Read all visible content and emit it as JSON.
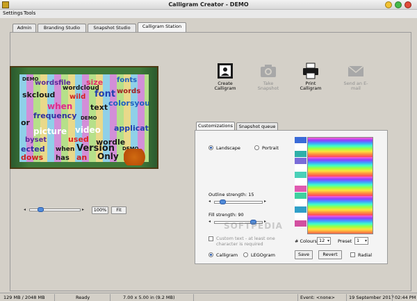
{
  "window": {
    "title": "Calligram Creator - DEMO"
  },
  "menu": [
    {
      "label": "Settings"
    },
    {
      "label": "Tools"
    }
  ],
  "tabs": [
    {
      "label": "Admin"
    },
    {
      "label": "Branding Studio"
    },
    {
      "label": "Snapshot Studio"
    },
    {
      "label": "Calligram Station",
      "active": true
    }
  ],
  "preview": {
    "words": [
      "DEMO",
      "wordsfile",
      "size",
      "fonts",
      "wordcloud",
      "skcloud",
      "wild",
      "font",
      "words",
      "when",
      "text",
      "colorsyou",
      "frequency",
      "or",
      "DEMO",
      "picture",
      "video",
      "applicati",
      "byset",
      "used",
      "wordle",
      "ected",
      "when",
      "Version",
      "dows",
      "has",
      "an",
      "Only",
      "DEMO"
    ],
    "zoom_label": "100%",
    "fit_label": "Fit"
  },
  "actions": [
    {
      "label": "Create Calligram",
      "icon": "portrait-frame-icon",
      "enabled": true
    },
    {
      "label": "Take Snapshot",
      "icon": "camera-icon",
      "enabled": false
    },
    {
      "label": "Print Calligram",
      "icon": "printer-icon",
      "enabled": true
    },
    {
      "label": "Send an E-mail",
      "icon": "envelope-icon",
      "enabled": false
    }
  ],
  "subtabs": [
    {
      "label": "Customizations",
      "active": true
    },
    {
      "label": "Snapshot queue"
    }
  ],
  "customizations": {
    "orientation": {
      "landscape": "Landscape",
      "portrait": "Portrait",
      "selected": "Landscape"
    },
    "outline_label": "Outline strength: 15",
    "outline_value": 15,
    "fill_label": "Fill strength: 90",
    "fill_value": 90,
    "custom_text_label": "Custom text - at least one character is required",
    "custom_text_checked": false,
    "mode": {
      "calligram": "Calligram",
      "legogram": "LEGOgram",
      "selected": "Calligram"
    },
    "colours_label": "# Colours",
    "colours_value": "12",
    "preset_label": "Preset",
    "preset_value": "1",
    "save_label": "Save",
    "revert_label": "Revert",
    "radial_label": "Radial",
    "radial_checked": false,
    "palette": [
      "#3a6bd8",
      "#ffffff",
      "#2fb0a8",
      "#7a6cd8",
      "#ffffff",
      "#4ad0b8",
      "#ffffff",
      "#e05ab0",
      "#3fd0a0",
      "#ffffff",
      "#2f9fc8",
      "#ffffff",
      "#d24fa0"
    ]
  },
  "status": {
    "memory": "129 MB / 2048 MB",
    "state": "Ready",
    "dimensions": "7.00 x 5.00 in  (9.2 MB)",
    "event": "Event: <none>",
    "date": "19 September 2017",
    "time": "02:44 PM"
  },
  "watermark": "SOFTPEDIA"
}
